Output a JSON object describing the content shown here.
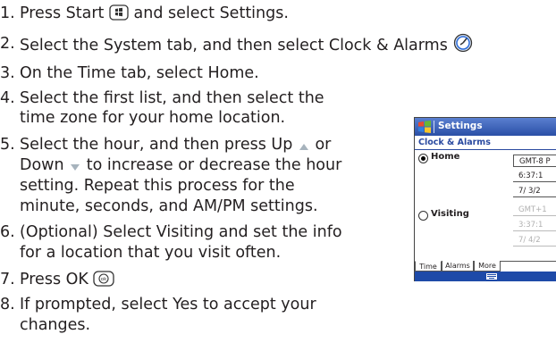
{
  "steps": [
    {
      "num": "1.",
      "lines": [
        "Press Start",
        " and select Settings."
      ]
    },
    {
      "num": "2.",
      "lines": [
        "Select the System tab, and then select Clock & Alarms"
      ]
    },
    {
      "num": "3.",
      "lines": [
        "On the Time tab, select Home."
      ]
    },
    {
      "num": "4.",
      "lines": [
        "Select the first list, and then select the",
        "time zone for your home location."
      ]
    },
    {
      "num": "5.",
      "lines": [
        "Select the hour, and then press Up",
        " or",
        "Down",
        " to increase or decrease the hour",
        "setting. Repeat this process for the",
        "minute, seconds, and AM/PM settings."
      ]
    },
    {
      "num": "6.",
      "lines": [
        "(Optional) Select Visiting and set the info",
        "for a location that you visit often."
      ]
    },
    {
      "num": "7.",
      "lines": [
        "Press OK"
      ]
    },
    {
      "num": "8.",
      "lines": [
        "If prompted, select Yes to accept your",
        "changes."
      ]
    }
  ],
  "icons": {
    "start": "windows-start-icon",
    "clock": "clock-alarms-icon",
    "up": "up-arrow-icon",
    "down": "down-arrow-icon",
    "ok": "ok-button-icon"
  },
  "device": {
    "title": "Settings",
    "subheader": "Clock & Alarms",
    "home_label": "Home",
    "visiting_label": "Visiting",
    "home_zone": "GMT-8 P",
    "home_time": "6:37:1",
    "home_date": "7/ 3/2",
    "visit_zone": "GMT+1",
    "visit_time": "3:37:1",
    "visit_date": "7/ 4/2",
    "tabs": [
      "Time",
      "Alarms",
      "More"
    ],
    "colors": {
      "titlebar": "#2a4fa6",
      "subheader_text": "#2a4aa0",
      "bottombar": "#1e4aa8"
    }
  }
}
